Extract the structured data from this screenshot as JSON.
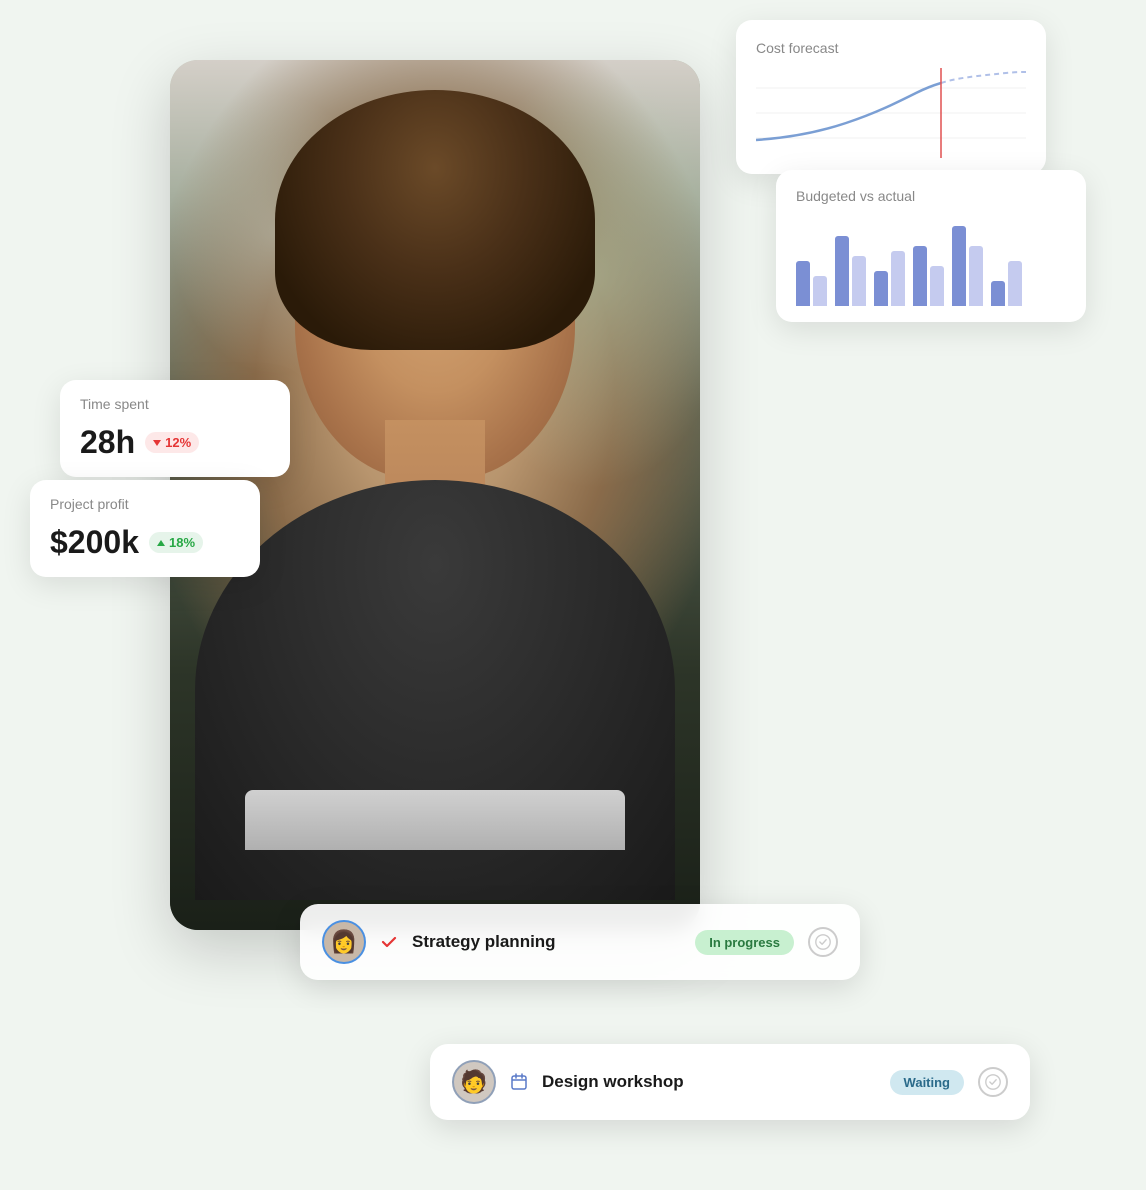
{
  "background_color": "#eef4ee",
  "cost_forecast_card": {
    "title": "Cost forecast",
    "chart": {
      "solid_line_color": "#7b9fd4",
      "dashed_line_color": "#b0c0e8",
      "vertical_line_color": "#e05050"
    }
  },
  "budgeted_vs_actual_card": {
    "title": "Budgeted vs actual",
    "bars": [
      {
        "dark": 45,
        "light": 30
      },
      {
        "dark": 70,
        "light": 50
      },
      {
        "dark": 35,
        "light": 55
      },
      {
        "dark": 60,
        "light": 40
      },
      {
        "dark": 80,
        "light": 60
      },
      {
        "dark": 25,
        "light": 45
      }
    ]
  },
  "time_spent_card": {
    "label": "Time spent",
    "value": "28h",
    "badge_value": "12%",
    "badge_type": "down",
    "badge_color_bg": "#fde8e8",
    "badge_color_text": "#e53535"
  },
  "project_profit_card": {
    "label": "Project profit",
    "value": "$200k",
    "badge_value": "18%",
    "badge_type": "up",
    "badge_color_bg": "#e6f4ea",
    "badge_color_text": "#27a845"
  },
  "strategy_task": {
    "name": "Strategy planning",
    "status": "In progress",
    "status_color": "#c8f0d0",
    "status_text_color": "#2a7a40",
    "icon_type": "checkmark"
  },
  "design_task": {
    "name": "Design workshop",
    "status": "Waiting",
    "status_color": "#d0e8f0",
    "status_text_color": "#2a6a8a",
    "icon_type": "calendar"
  }
}
